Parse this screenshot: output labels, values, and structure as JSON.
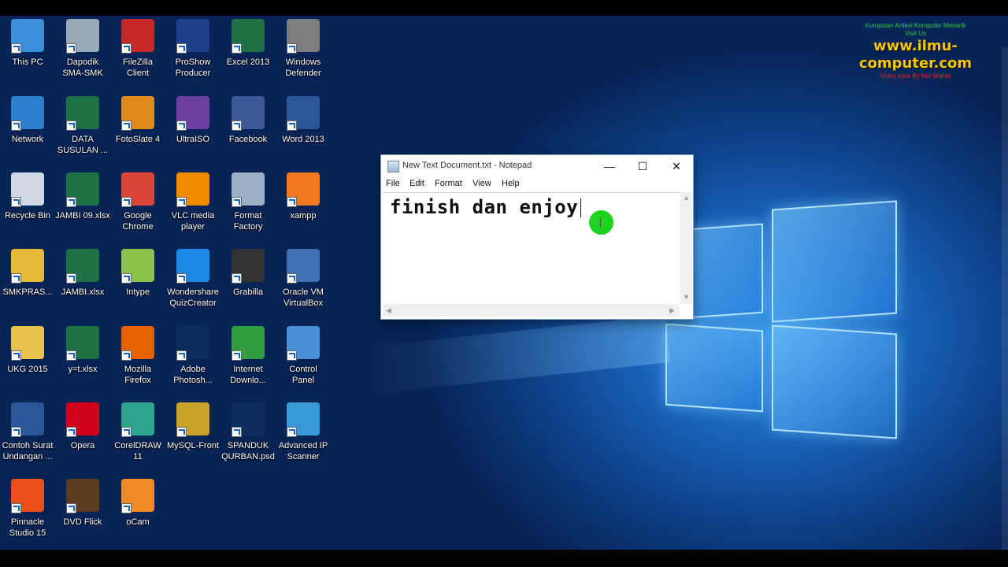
{
  "desktop": {
    "icons": [
      {
        "label": "This PC",
        "icon": "computer-icon",
        "color": "#3a8fd8"
      },
      {
        "label": "Dapodik\nSMA-SMK",
        "icon": "database-icon",
        "color": "#9aa8b8"
      },
      {
        "label": "FileZilla\nClient",
        "icon": "filezilla-icon",
        "color": "#c62828"
      },
      {
        "label": "ProShow\nProducer",
        "icon": "proshow-icon",
        "color": "#1e3f8a"
      },
      {
        "label": "Excel 2013",
        "icon": "excel-icon",
        "color": "#1e7145"
      },
      {
        "label": "Windows\nDefender",
        "icon": "defender-icon",
        "color": "#7d7d7d"
      },
      {
        "label": "Network",
        "icon": "network-icon",
        "color": "#2d7fd0"
      },
      {
        "label": "DATA\nSUSULAN ...",
        "icon": "excel-file-icon",
        "color": "#1e7145"
      },
      {
        "label": "FotoSlate 4",
        "icon": "fotoslate-icon",
        "color": "#e08a1e"
      },
      {
        "label": "UltraISO",
        "icon": "disc-icon",
        "color": "#6a3fa0"
      },
      {
        "label": "Facebook",
        "icon": "facebook-icon",
        "color": "#3b5998"
      },
      {
        "label": "Word 2013",
        "icon": "word-icon",
        "color": "#2b579a"
      },
      {
        "label": "Recycle Bin",
        "icon": "recycle-bin-icon",
        "color": "#cfd8e3"
      },
      {
        "label": "JAMBI 09.xlsx",
        "icon": "excel-file-icon",
        "color": "#1e7145"
      },
      {
        "label": "Google\nChrome",
        "icon": "chrome-icon",
        "color": "#db4437"
      },
      {
        "label": "VLC media\nplayer",
        "icon": "vlc-icon",
        "color": "#f28a00"
      },
      {
        "label": "Format\nFactory",
        "icon": "format-factory-icon",
        "color": "#9db0c6"
      },
      {
        "label": "xampp",
        "icon": "xampp-icon",
        "color": "#f37a1f"
      },
      {
        "label": "SMKPRAS...",
        "icon": "user-folder-icon",
        "color": "#e5b93a"
      },
      {
        "label": "JAMBI.xlsx",
        "icon": "excel-file-icon",
        "color": "#1e7145"
      },
      {
        "label": "Intype",
        "icon": "intype-icon",
        "color": "#8bc34a"
      },
      {
        "label": "Wondershare\nQuizCreator",
        "icon": "quizcreator-icon",
        "color": "#1e88e5"
      },
      {
        "label": "Grabilla",
        "icon": "grabilla-icon",
        "color": "#333333"
      },
      {
        "label": "Oracle VM\nVirtualBox",
        "icon": "virtualbox-icon",
        "color": "#3f6fb5"
      },
      {
        "label": "UKG 2015",
        "icon": "folder-icon",
        "color": "#e8c24a"
      },
      {
        "label": "y=t.xlsx",
        "icon": "excel-file-icon",
        "color": "#1e7145"
      },
      {
        "label": "Mozilla\nFirefox",
        "icon": "firefox-icon",
        "color": "#e66000"
      },
      {
        "label": "Adobe\nPhotosh...",
        "icon": "photoshop-icon",
        "color": "#0b2d5c"
      },
      {
        "label": "Internet\nDownlo...",
        "icon": "idm-icon",
        "color": "#2e9e3e"
      },
      {
        "label": "Control\nPanel",
        "icon": "control-panel-icon",
        "color": "#4a90d9"
      },
      {
        "label": "Contoh Surat\nUndangan ...",
        "icon": "word-file-icon",
        "color": "#2b579a"
      },
      {
        "label": "Opera",
        "icon": "opera-icon",
        "color": "#d0021b"
      },
      {
        "label": "CorelDRAW\n11",
        "icon": "coreldraw-icon",
        "color": "#2aa58b"
      },
      {
        "label": "MySQL-Front",
        "icon": "mysql-front-icon",
        "color": "#c9a227"
      },
      {
        "label": "SPANDUK\nQURBAN.psd",
        "icon": "psd-file-icon",
        "color": "#0b2d5c"
      },
      {
        "label": "Advanced IP\nScanner",
        "icon": "ip-scanner-icon",
        "color": "#3a9ad9"
      },
      {
        "label": "Pinnacle\nStudio 15",
        "icon": "pinnacle-icon",
        "color": "#e94e1b"
      },
      {
        "label": "DVD Flick",
        "icon": "dvd-flick-icon",
        "color": "#5b3d1e"
      },
      {
        "label": "oCam",
        "icon": "ocam-icon",
        "color": "#f08a24"
      }
    ]
  },
  "watermark": {
    "line1": "Kumpulan Artikel Komputer Menarik",
    "line2": "Visit Us",
    "site": "www.ilmu-computer.com",
    "credit": "Video tutor By Nur Wahid"
  },
  "notepad": {
    "title": "New Text Document.txt - Notepad",
    "menu": [
      "File",
      "Edit",
      "Format",
      "View",
      "Help"
    ],
    "content": "finish dan enjoy",
    "minimize_glyph": "—",
    "maximize_glyph": "☐",
    "close_glyph": "✕"
  }
}
